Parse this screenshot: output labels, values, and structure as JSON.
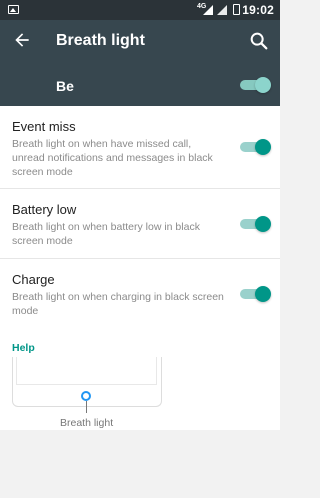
{
  "status_bar": {
    "network": "4G",
    "time": "19:02"
  },
  "toolbar": {
    "title": "Breath light"
  },
  "master": {
    "label": "Be",
    "enabled": true
  },
  "settings": [
    {
      "title": "Event miss",
      "summary": "Breath light on when have missed call, unread notifications and messages in black screen mode",
      "enabled": true
    },
    {
      "title": "Battery low",
      "summary": "Breath light on when battery low in black screen mode",
      "enabled": true
    },
    {
      "title": "Charge",
      "summary": "Breath light on when charging in black screen mode",
      "enabled": true
    }
  ],
  "help": {
    "heading": "Help",
    "caption": "Breath light"
  },
  "colors": {
    "toolbar": "#37474f",
    "status_bar": "#2b3338",
    "accent": "#009688",
    "led": "#2196f3"
  }
}
